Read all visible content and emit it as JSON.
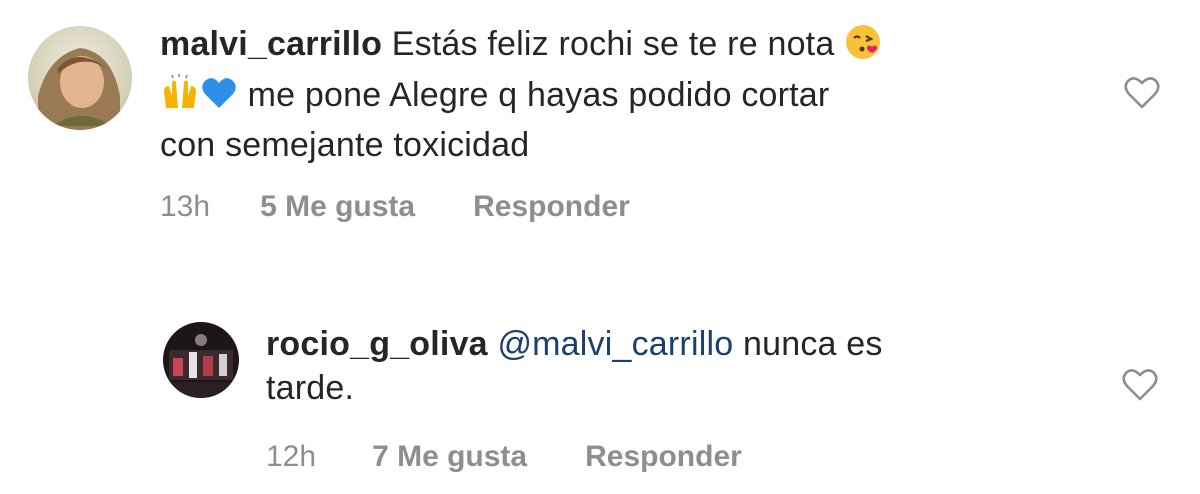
{
  "comments": [
    {
      "username": "malvi_carrillo",
      "text_line1": " Estás feliz rochi se te re nota ",
      "emoji1": "face-blowing-kiss-emoji",
      "emoji2": "raising-hands-emoji",
      "emoji3": "blue-heart-emoji",
      "text_line2": " me pone Alegre q hayas podido cortar",
      "text_line3": "con semejante toxicidad",
      "time": "13h",
      "likes": "5 Me gusta",
      "reply": "Responder"
    },
    {
      "username": "rocio_g_oliva",
      "mention": " @malvi_carrillo",
      "text_line1": " nunca es",
      "text_line2": "tarde.",
      "time": "12h",
      "likes": "7 Me gusta",
      "reply": "Responder"
    }
  ],
  "colors": {
    "text": "#262626",
    "meta": "#8e8e8e",
    "mention": "#1d3f6e"
  }
}
